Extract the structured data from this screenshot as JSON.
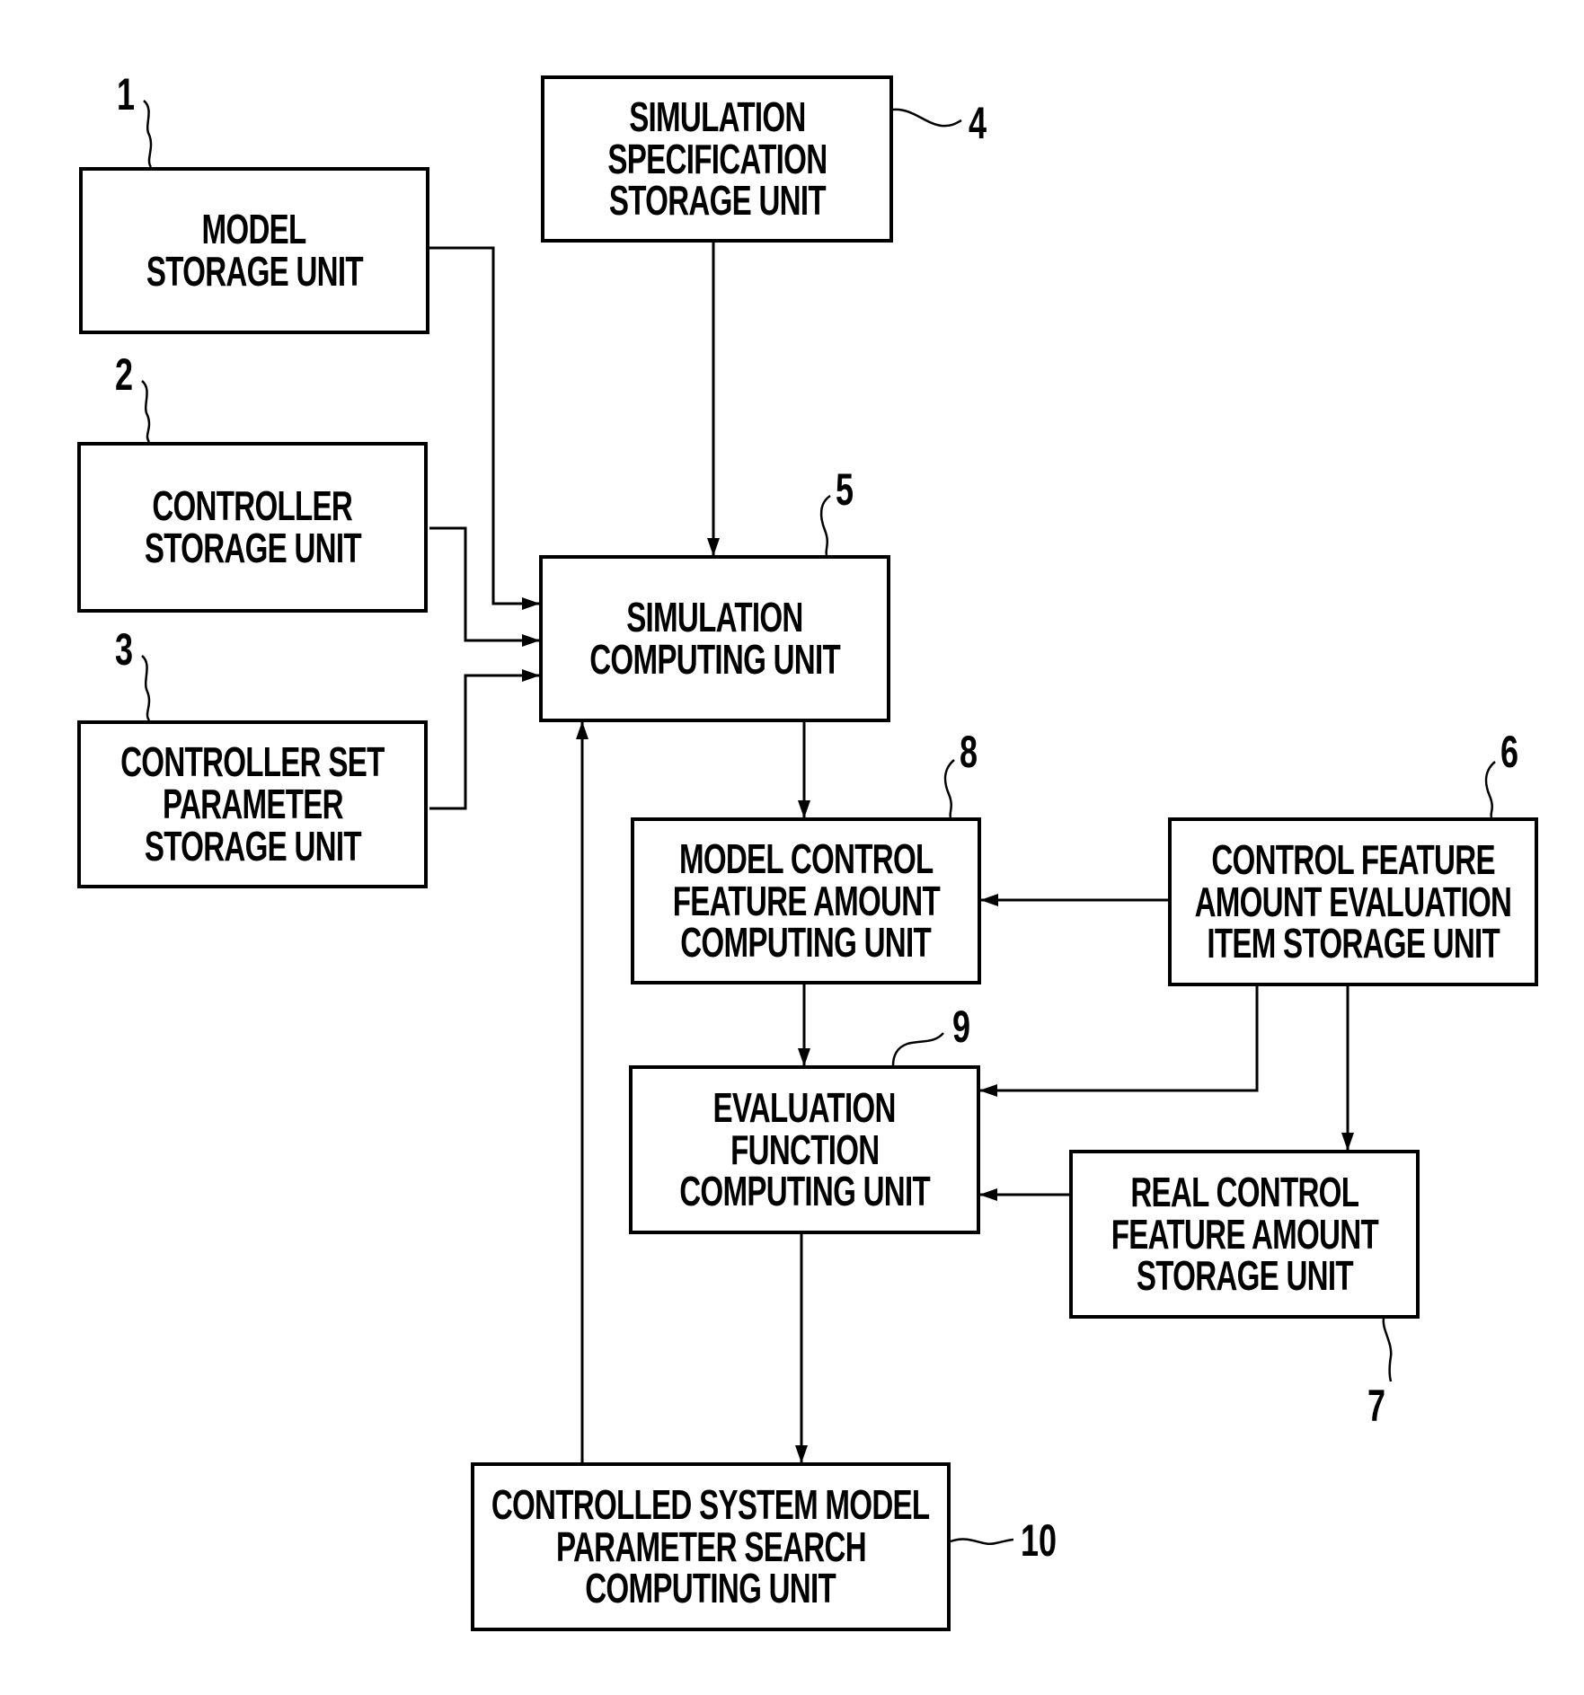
{
  "figure": {
    "type": "block-diagram",
    "blocks": [
      {
        "id": "1",
        "ref": "1",
        "name": "model-storage-unit",
        "lines": [
          "MODEL",
          "STORAGE UNIT"
        ]
      },
      {
        "id": "2",
        "ref": "2",
        "name": "controller-storage-unit",
        "lines": [
          "CONTROLLER",
          "STORAGE UNIT"
        ]
      },
      {
        "id": "3",
        "ref": "3",
        "name": "controller-set-parameter-storage-unit",
        "lines": [
          "CONTROLLER SET",
          "PARAMETER",
          "STORAGE UNIT"
        ]
      },
      {
        "id": "4",
        "ref": "4",
        "name": "simulation-specification-storage-unit",
        "lines": [
          "SIMULATION",
          "SPECIFICATION",
          "STORAGE UNIT"
        ]
      },
      {
        "id": "5",
        "ref": "5",
        "name": "simulation-computing-unit",
        "lines": [
          "SIMULATION",
          "COMPUTING UNIT"
        ]
      },
      {
        "id": "6",
        "ref": "6",
        "name": "control-feature-amount-evaluation-item-storage-unit",
        "lines": [
          "CONTROL FEATURE",
          "AMOUNT EVALUATION",
          "ITEM STORAGE UNIT"
        ]
      },
      {
        "id": "7",
        "ref": "7",
        "name": "real-control-feature-amount-storage-unit",
        "lines": [
          "REAL CONTROL",
          "FEATURE AMOUNT",
          "STORAGE UNIT"
        ]
      },
      {
        "id": "8",
        "ref": "8",
        "name": "model-control-feature-amount-computing-unit",
        "lines": [
          "MODEL CONTROL",
          "FEATURE AMOUNT",
          "COMPUTING UNIT"
        ]
      },
      {
        "id": "9",
        "ref": "9",
        "name": "evaluation-function-computing-unit",
        "lines": [
          "EVALUATION",
          "FUNCTION",
          "COMPUTING UNIT"
        ]
      },
      {
        "id": "10",
        "ref": "10",
        "name": "controlled-system-model-parameter-search-computing-unit",
        "lines": [
          "CONTROLLED SYSTEM MODEL",
          "PARAMETER SEARCH",
          "COMPUTING UNIT"
        ]
      }
    ],
    "connections": [
      {
        "from": "1",
        "to": "5"
      },
      {
        "from": "2",
        "to": "5"
      },
      {
        "from": "3",
        "to": "5"
      },
      {
        "from": "4",
        "to": "5"
      },
      {
        "from": "10",
        "to": "5"
      },
      {
        "from": "5",
        "to": "8"
      },
      {
        "from": "6",
        "to": "8"
      },
      {
        "from": "8",
        "to": "9"
      },
      {
        "from": "6",
        "to": "9"
      },
      {
        "from": "6",
        "to": "7"
      },
      {
        "from": "7",
        "to": "9"
      },
      {
        "from": "9",
        "to": "10"
      }
    ],
    "line_color": "#000000",
    "background": "#ffffff"
  }
}
